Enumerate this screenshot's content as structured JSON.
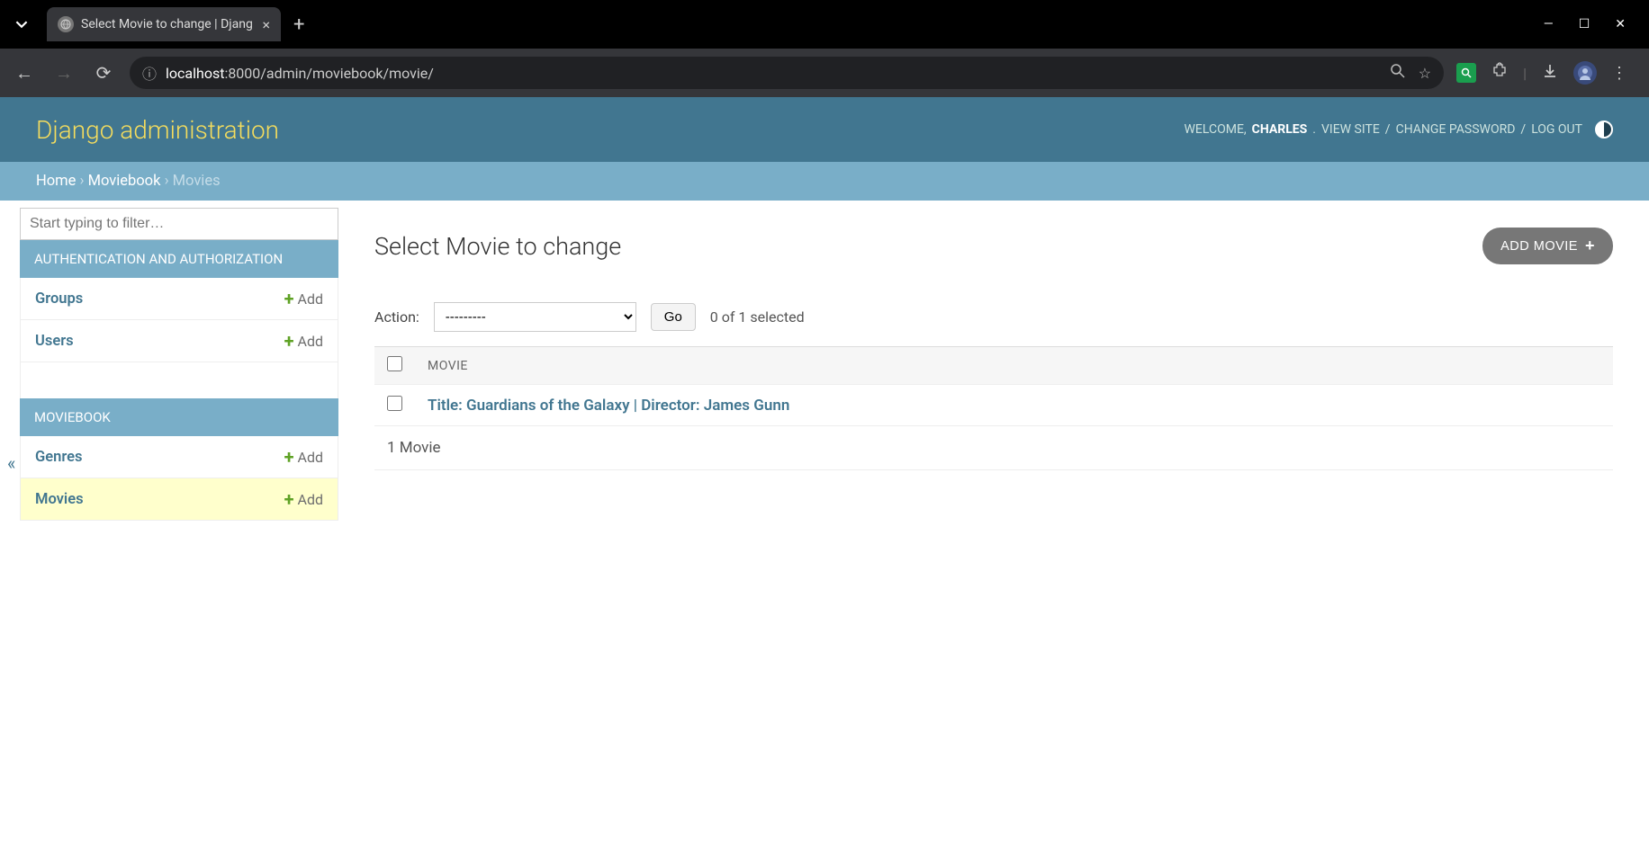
{
  "browser": {
    "tab_title": "Select Movie to change | Djang",
    "url_host": "localhost",
    "url_path": ":8000/admin/moviebook/movie/"
  },
  "header": {
    "title": "Django administration",
    "welcome": "WELCOME,",
    "username": "CHARLES",
    "view_site": "VIEW SITE",
    "change_password": "CHANGE PASSWORD",
    "logout": "LOG OUT"
  },
  "breadcrumbs": {
    "home": "Home",
    "app": "Moviebook",
    "model": "Movies"
  },
  "sidebar": {
    "filter_placeholder": "Start typing to filter…",
    "apps": [
      {
        "label": "AUTHENTICATION AND AUTHORIZATION",
        "models": [
          {
            "name": "Groups",
            "add": "Add",
            "selected": false
          },
          {
            "name": "Users",
            "add": "Add",
            "selected": false
          }
        ]
      },
      {
        "label": "MOVIEBOOK",
        "models": [
          {
            "name": "Genres",
            "add": "Add",
            "selected": false
          },
          {
            "name": "Movies",
            "add": "Add",
            "selected": true
          }
        ]
      }
    ]
  },
  "content": {
    "heading": "Select Movie to change",
    "add_button": "ADD MOVIE",
    "actions": {
      "label": "Action:",
      "placeholder": "---------",
      "go": "Go",
      "selection": "0 of 1 selected"
    },
    "table": {
      "column": "MOVIE",
      "rows": [
        {
          "title": "Title: Guardians of the Galaxy | Director: James Gunn"
        }
      ],
      "footer": "1 Movie"
    }
  }
}
